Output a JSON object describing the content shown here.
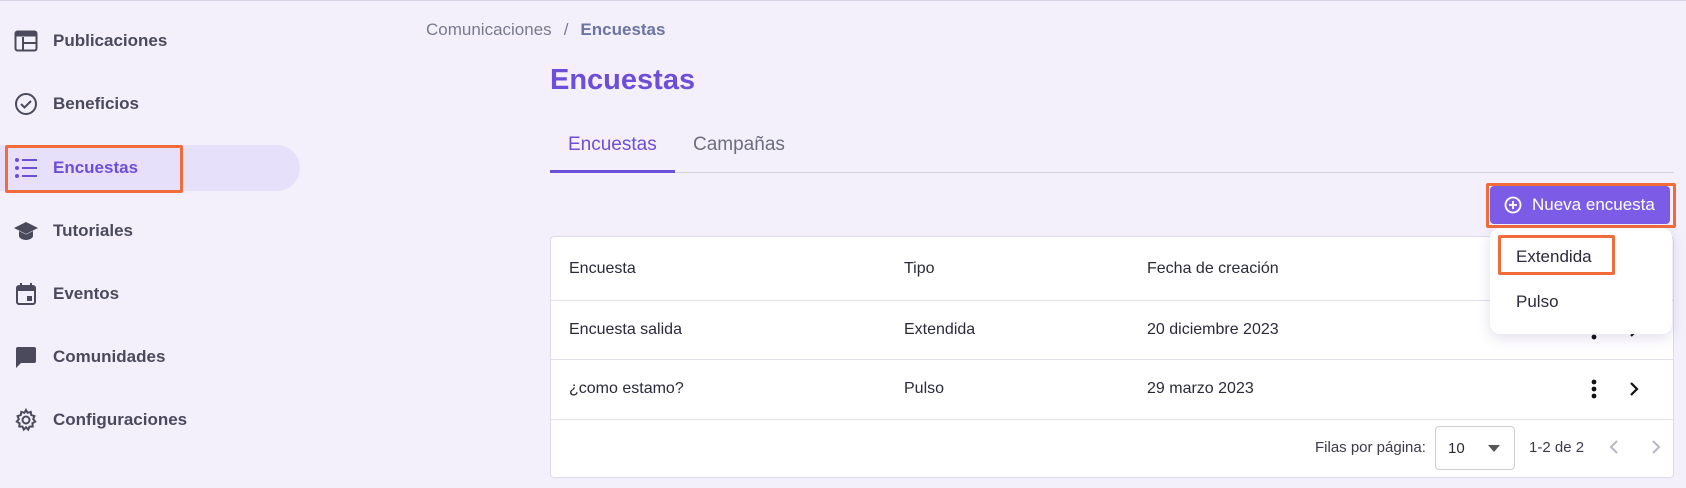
{
  "sidebar": {
    "items": [
      {
        "label": "Publicaciones",
        "icon": "publications-icon"
      },
      {
        "label": "Beneficios",
        "icon": "check-circle-icon"
      },
      {
        "label": "Encuestas",
        "icon": "list-icon",
        "active": true
      },
      {
        "label": "Tutoriales",
        "icon": "graduation-cap-icon"
      },
      {
        "label": "Eventos",
        "icon": "calendar-icon"
      },
      {
        "label": "Comunidades",
        "icon": "chat-bubble-icon"
      },
      {
        "label": "Configuraciones",
        "icon": "gear-icon"
      }
    ]
  },
  "breadcrumb": {
    "parent": "Comunicaciones",
    "separator": "/",
    "current": "Encuestas"
  },
  "page": {
    "title": "Encuestas"
  },
  "tabs": [
    {
      "label": "Encuestas",
      "active": true
    },
    {
      "label": "Campañas",
      "active": false
    }
  ],
  "new_button": {
    "label": "Nueva encuesta",
    "icon": "plus-circle-icon"
  },
  "table": {
    "columns": [
      "Encuesta",
      "Tipo",
      "Fecha de creación"
    ],
    "rows": [
      {
        "name": "Encuesta salida",
        "type": "Extendida",
        "date": "20 diciembre 2023"
      },
      {
        "name": "¿como estamo?",
        "type": "Pulso",
        "date": "29 marzo 2023"
      }
    ]
  },
  "pagination": {
    "rows_label": "Filas por página:",
    "rows_value": "10",
    "range": "1-2 de 2"
  },
  "dropdown": {
    "options": [
      "Extendida",
      "Pulso"
    ]
  },
  "colors": {
    "accent": "#6a4fd8",
    "button": "#7c5ce6",
    "highlight": "#f26b3a",
    "background": "#f3f0fc"
  }
}
